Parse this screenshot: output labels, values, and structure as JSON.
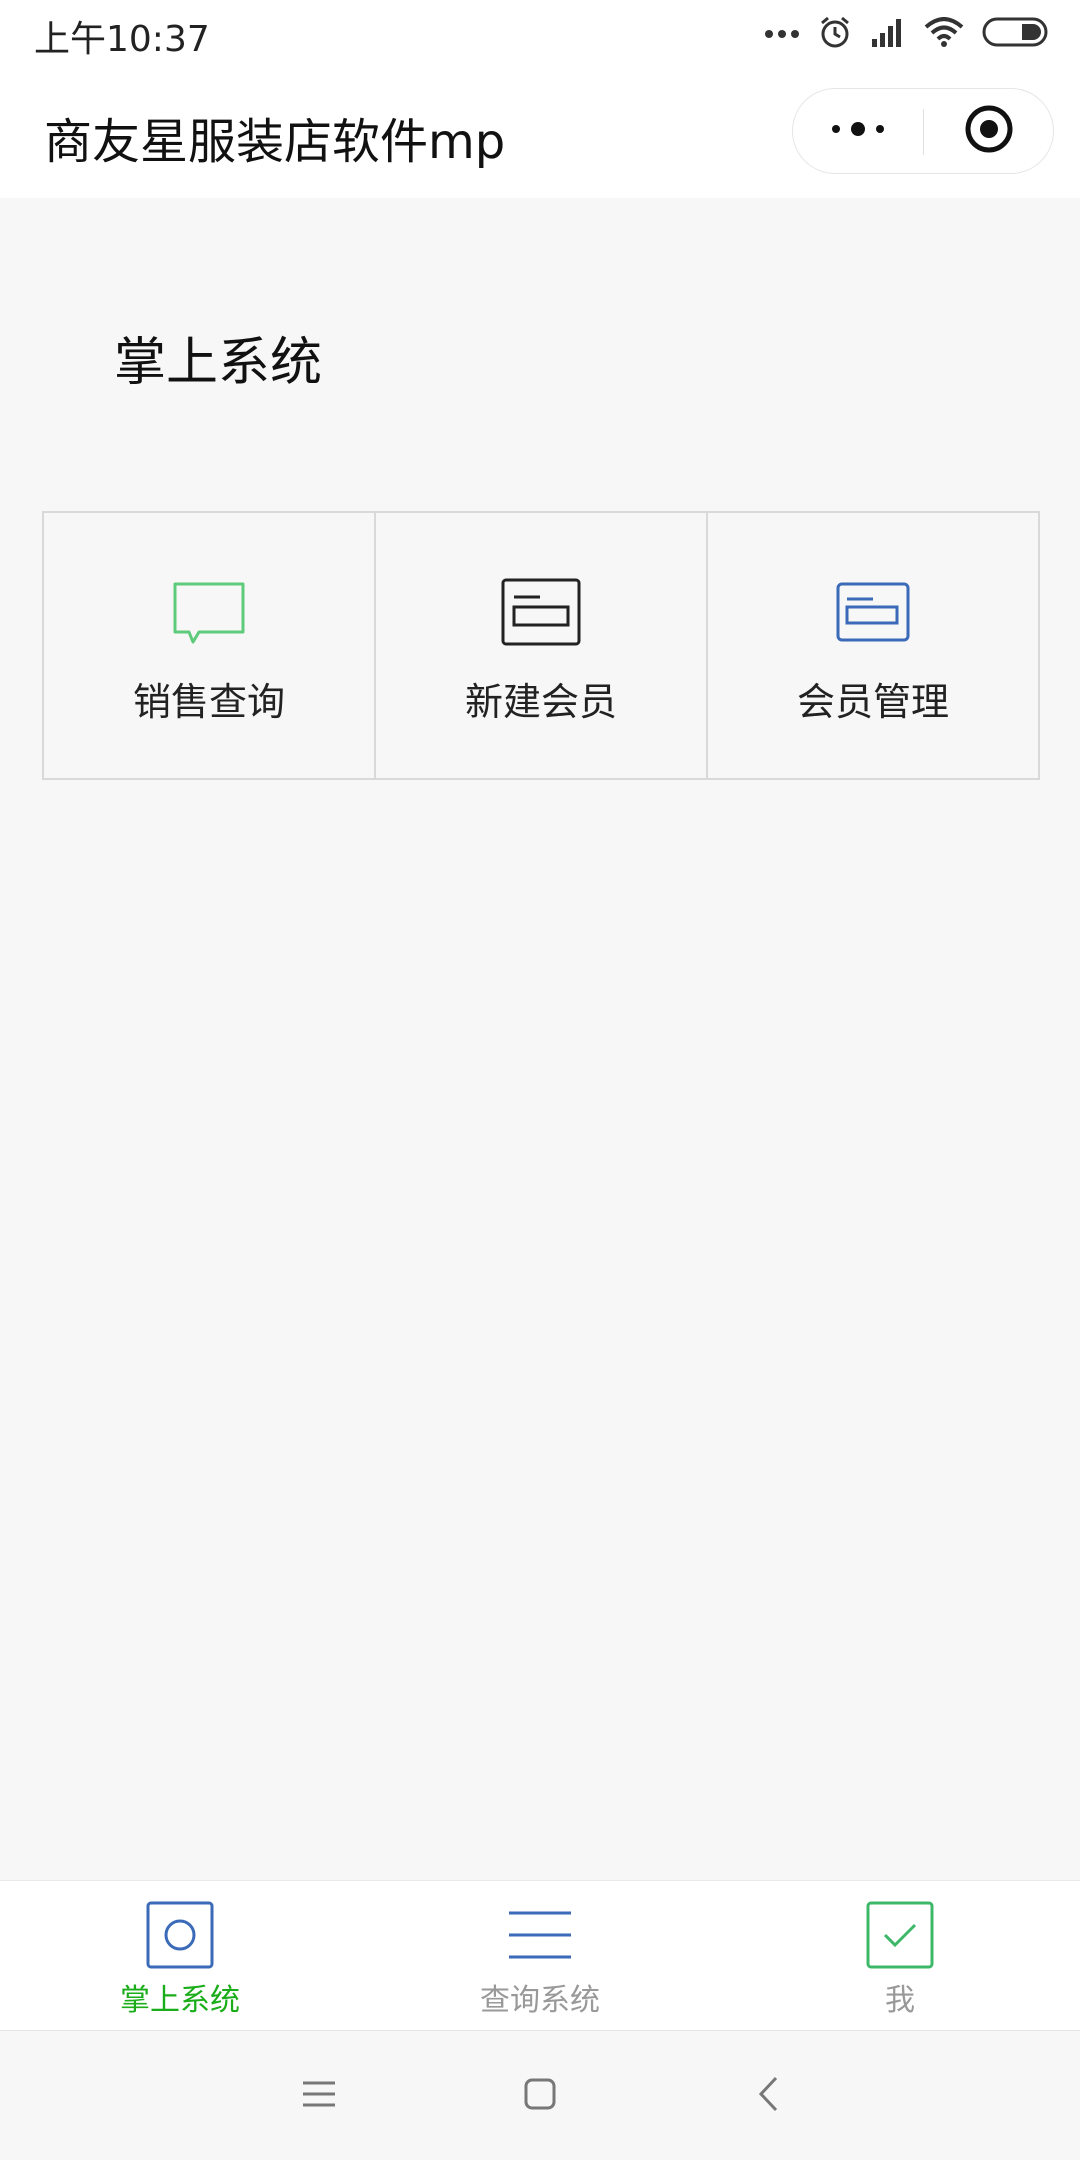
{
  "status_bar": {
    "time": "上午10:37",
    "icons": [
      "more-dots-icon",
      "alarm-icon",
      "signal-icon",
      "wifi-icon",
      "battery-icon"
    ]
  },
  "nav_bar": {
    "title": "商友星服装店软件mp",
    "capsule": [
      "more-icon",
      "close-miniprogram-icon"
    ]
  },
  "main": {
    "section_title": "掌上系统",
    "grid": [
      {
        "label": "销售查询",
        "icon": "chat-bubble-icon",
        "color": "#5ecb7a"
      },
      {
        "label": "新建会员",
        "icon": "card-icon",
        "color": "#222222"
      },
      {
        "label": "会员管理",
        "icon": "card-icon",
        "color": "#3a6ab8"
      }
    ]
  },
  "tab_bar": {
    "tabs": [
      {
        "label": "掌上系统",
        "icon": "circle-square-icon",
        "active": true
      },
      {
        "label": "查询系统",
        "icon": "menu-lines-icon",
        "active": false
      },
      {
        "label": "我",
        "icon": "checkbox-icon",
        "active": false
      }
    ]
  },
  "colors": {
    "active_tab": "#1aad19",
    "inactive_tab": "#999999",
    "icon_blue": "#3a6ab8",
    "icon_green": "#5ecb7a"
  },
  "android_nav": [
    "menu-icon",
    "home-icon",
    "back-icon"
  ]
}
